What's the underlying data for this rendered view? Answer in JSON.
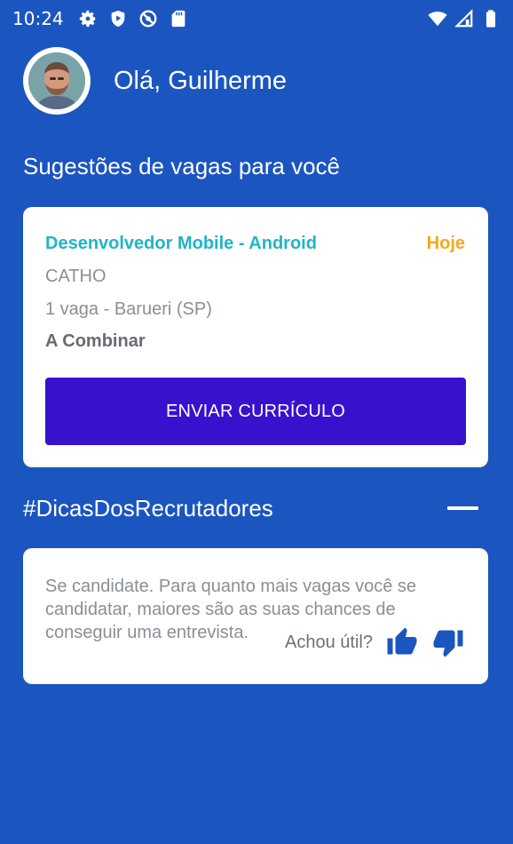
{
  "status_bar": {
    "time": "10:24",
    "left_icons": [
      "gear-icon",
      "shield-play-icon",
      "no-disturb-icon",
      "sd-card-icon"
    ],
    "right_icons": [
      "wifi-icon",
      "signal-icon",
      "battery-icon"
    ]
  },
  "header": {
    "greeting": "Olá, Guilherme"
  },
  "suggestions": {
    "title": "Sugestões de vagas para você",
    "job": {
      "title": "Desenvolvedor Mobile - Android",
      "date": "Hoje",
      "company": "CATHO",
      "location": "1 vaga - Barueri (SP)",
      "salary": "A Combinar",
      "button_label": "ENVIAR CURRÍCULO"
    }
  },
  "tips": {
    "title": "#DicasDosRecrutadores",
    "text": "Se candidate. Para quanto mais vagas você se candidatar, maiores são as suas chances de conseguir uma entrevista.",
    "useful_label": "Achou útil?"
  },
  "colors": {
    "background": "#1b55c0",
    "primary_button": "#3a10cf",
    "job_title": "#1fb4c8",
    "date_accent": "#f6a623"
  }
}
